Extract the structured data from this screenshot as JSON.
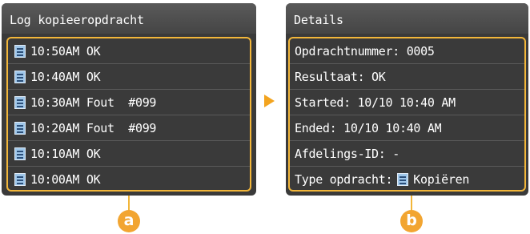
{
  "log_panel": {
    "title": "Log kopieeropdracht",
    "items": [
      {
        "label": "10:50AM OK"
      },
      {
        "label": "10:40AM OK"
      },
      {
        "label": "10:30AM Fout  #099"
      },
      {
        "label": "10:20AM Fout  #099"
      },
      {
        "label": "10:10AM OK"
      },
      {
        "label": "10:00AM OK"
      }
    ]
  },
  "details_panel": {
    "title": "Details",
    "rows": [
      {
        "label": "Opdrachtnummer: 0005"
      },
      {
        "label": "Resultaat: OK"
      },
      {
        "label": "Started: 10/10 10:40 AM"
      },
      {
        "label": "Ended: 10/10 10:40 AM"
      },
      {
        "label": "Afdelings-ID: -"
      },
      {
        "label": "Type opdracht:",
        "value": "Kopiëren",
        "icon": "copy-job-icon"
      }
    ]
  },
  "callouts": {
    "a": "a",
    "b": "b"
  },
  "colors": {
    "screen_bg": "#3a3a3a",
    "highlight": "#f2b63a",
    "arrow": "#f3a41f",
    "callout": "#f2a531"
  }
}
